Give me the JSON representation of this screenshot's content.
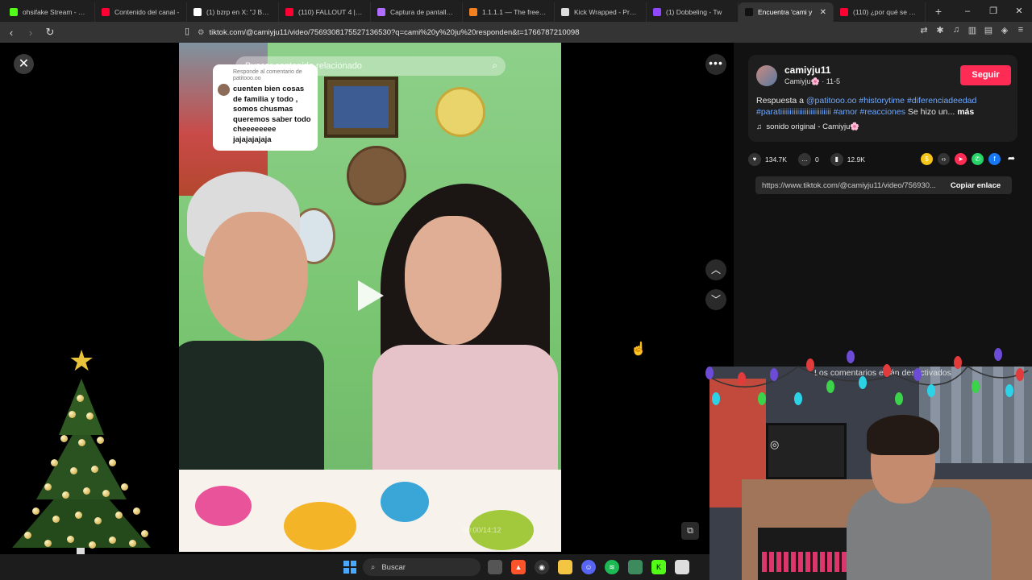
{
  "browser": {
    "tabs": [
      {
        "title": "ohsifake Stream - Watc",
        "fav": "#53fc18"
      },
      {
        "title": "Contenido del canal - ",
        "fav": "#ff0033"
      },
      {
        "title": "(1) bzrp en X: \"J BALVIN",
        "fav": "#ffffff"
      },
      {
        "title": "(110) FALLOUT 4 | PRIM",
        "fav": "#ff0033"
      },
      {
        "title": "Captura de pantalla po",
        "fav": "#b06cff"
      },
      {
        "title": "1.1.1.1 — The free app",
        "fav": "#f38020"
      },
      {
        "title": "Kick Wrapped - Proces",
        "fav": "#dddddd"
      },
      {
        "title": "(1) Dobbeling - Tw",
        "fav": "#9146ff"
      },
      {
        "title": "Encuentra 'cami y",
        "fav": "#111111",
        "active": true
      },
      {
        "title": "(110) ¿por qué se hace",
        "fav": "#ff0033"
      }
    ],
    "new_tab": "+",
    "url": "tiktok.com/@camiyju11/video/7569308175527136530?q=cami%20y%20ju%20responden&t=1766787210098",
    "window_controls": [
      "–",
      "❐",
      "✕"
    ]
  },
  "player": {
    "search_placeholder": "Buscar contenido relacionado",
    "reply_meta_line1": "Responde al comentario de",
    "reply_meta_line2": "patitooo.oo",
    "reply_text": "cuenten bien cosas de familia y todo , somos chusmas queremos saber todo cheeeeeeee jajajajajaja",
    "timestamp": "00:00/14:12"
  },
  "sidebar": {
    "username": "camiyju11",
    "nickname": "Camiyju🌸 · 11-5",
    "follow_label": "Seguir",
    "desc_prefix": "Respuesta a ",
    "desc_mention": "@patitooo.oo",
    "desc_tags": "#historytime #diferenciadeedad #paratiiiiiiiiiiiiiiiiiiiiiiiiiii #amor #reacciones",
    "desc_suffix": " Se hizo un...",
    "desc_more": "más",
    "music": "sonido original - Camiyju🌸",
    "likes": "134.7K",
    "comments": "0",
    "saves": "12.9K",
    "link": "https://www.tiktok.com/@camiyju11/video/756930...",
    "copy_label": "Copiar enlace",
    "comments_disabled": "Los comentarios están desactivados"
  },
  "taskbar": {
    "search_label": "Buscar"
  }
}
